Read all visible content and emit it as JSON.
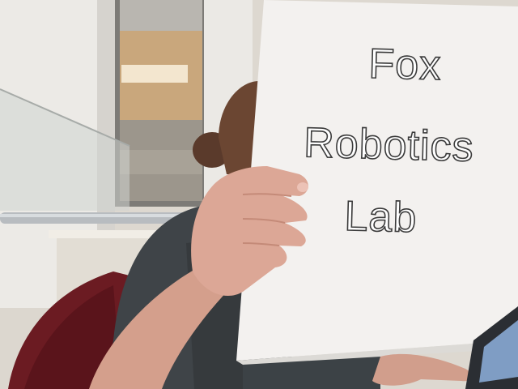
{
  "photo": {
    "sign": {
      "lines": [
        "Fox",
        "Robotics",
        "Lab"
      ]
    }
  },
  "colors": {
    "paper": "#f3f1ef",
    "wall": "#e9e7e4",
    "ceiling": "#c9a77c",
    "chair": "#6b1b22",
    "shirt": "#3f4448",
    "skin": "#d9a493",
    "hair": "#5a3a2b"
  }
}
